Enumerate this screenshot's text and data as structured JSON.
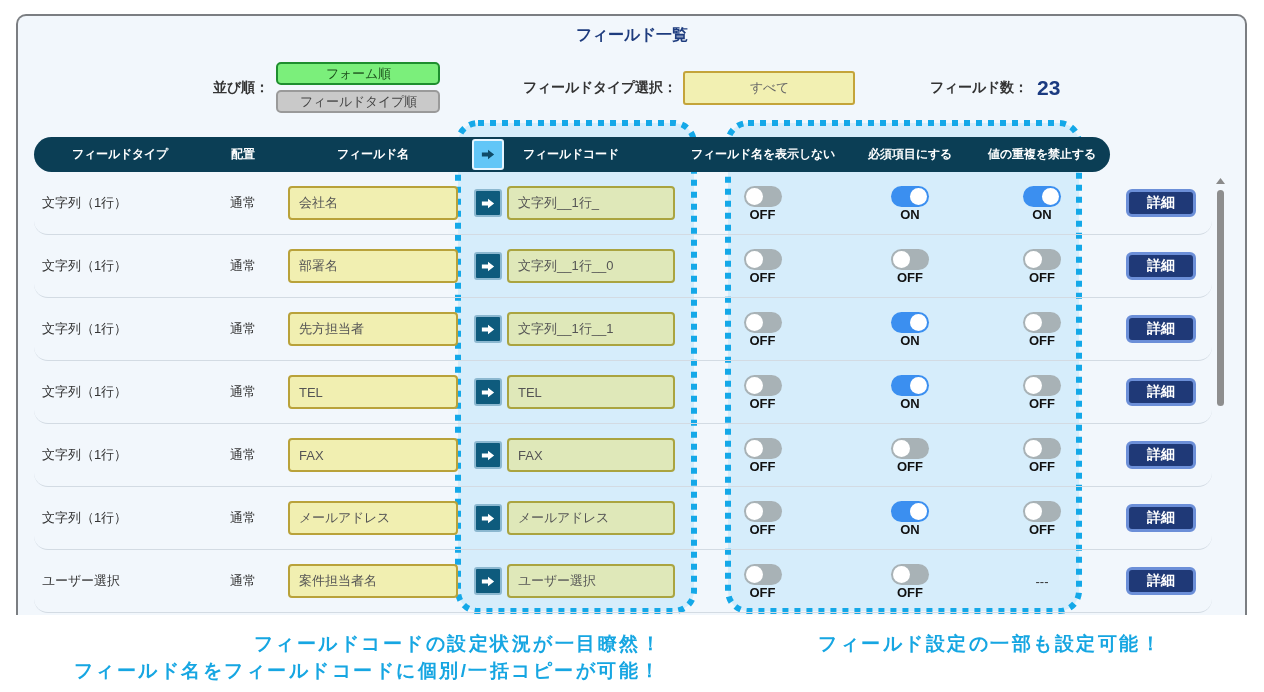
{
  "panel": {
    "title": "フィールド一覧"
  },
  "sort": {
    "label": "並び順：",
    "options": [
      {
        "label": "フォーム順",
        "selected": true
      },
      {
        "label": "フィールドタイプ順",
        "selected": false
      }
    ]
  },
  "type_filter": {
    "label": "フィールドタイプ選択：",
    "value": "すべて"
  },
  "field_count": {
    "label": "フィールド数：",
    "value": "23"
  },
  "table": {
    "columns": [
      "フィールドタイプ",
      "配置",
      "フィールド名",
      "フィールドコード",
      "フィールド名を表示しない",
      "必須項目にする",
      "値の重複を禁止する"
    ],
    "rows": [
      {
        "type": "文字列（1行）",
        "placement": "通常",
        "name": "会社名",
        "code": "文字列__1行_",
        "settings": [
          {
            "kind": "toggle",
            "on": false,
            "label": "OFF"
          },
          {
            "kind": "toggle",
            "on": true,
            "label": "ON"
          },
          {
            "kind": "toggle",
            "on": true,
            "label": "ON"
          }
        ],
        "detail": "詳細"
      },
      {
        "type": "文字列（1行）",
        "placement": "通常",
        "name": "部署名",
        "code": "文字列__1行__0",
        "settings": [
          {
            "kind": "toggle",
            "on": false,
            "label": "OFF"
          },
          {
            "kind": "toggle",
            "on": false,
            "label": "OFF"
          },
          {
            "kind": "toggle",
            "on": false,
            "label": "OFF"
          }
        ],
        "detail": "詳細"
      },
      {
        "type": "文字列（1行）",
        "placement": "通常",
        "name": "先方担当者",
        "code": "文字列__1行__1",
        "settings": [
          {
            "kind": "toggle",
            "on": false,
            "label": "OFF"
          },
          {
            "kind": "toggle",
            "on": true,
            "label": "ON"
          },
          {
            "kind": "toggle",
            "on": false,
            "label": "OFF"
          }
        ],
        "detail": "詳細"
      },
      {
        "type": "文字列（1行）",
        "placement": "通常",
        "name": "TEL",
        "code": "TEL",
        "settings": [
          {
            "kind": "toggle",
            "on": false,
            "label": "OFF"
          },
          {
            "kind": "toggle",
            "on": true,
            "label": "ON"
          },
          {
            "kind": "toggle",
            "on": false,
            "label": "OFF"
          }
        ],
        "detail": "詳細"
      },
      {
        "type": "文字列（1行）",
        "placement": "通常",
        "name": "FAX",
        "code": "FAX",
        "settings": [
          {
            "kind": "toggle",
            "on": false,
            "label": "OFF"
          },
          {
            "kind": "toggle",
            "on": false,
            "label": "OFF"
          },
          {
            "kind": "toggle",
            "on": false,
            "label": "OFF"
          }
        ],
        "detail": "詳細"
      },
      {
        "type": "文字列（1行）",
        "placement": "通常",
        "name": "メールアドレス",
        "code": "メールアドレス",
        "settings": [
          {
            "kind": "toggle",
            "on": false,
            "label": "OFF"
          },
          {
            "kind": "toggle",
            "on": true,
            "label": "ON"
          },
          {
            "kind": "toggle",
            "on": false,
            "label": "OFF"
          }
        ],
        "detail": "詳細"
      },
      {
        "type": "ユーザー選択",
        "placement": "通常",
        "name": "案件担当者名",
        "code": "ユーザー選択",
        "settings": [
          {
            "kind": "toggle",
            "on": false,
            "label": "OFF"
          },
          {
            "kind": "toggle",
            "on": false,
            "label": "OFF"
          },
          {
            "kind": "text",
            "label": "---"
          }
        ],
        "detail": "詳細"
      }
    ]
  },
  "callouts": [
    {
      "lines": [
        "フィールドコードの設定状況が一目瞭然！",
        "フィールド名をフィールドコードに個別/一括コピーが可能！"
      ]
    },
    {
      "lines": [
        "フィールド設定の一部も設定可能！"
      ]
    }
  ]
}
